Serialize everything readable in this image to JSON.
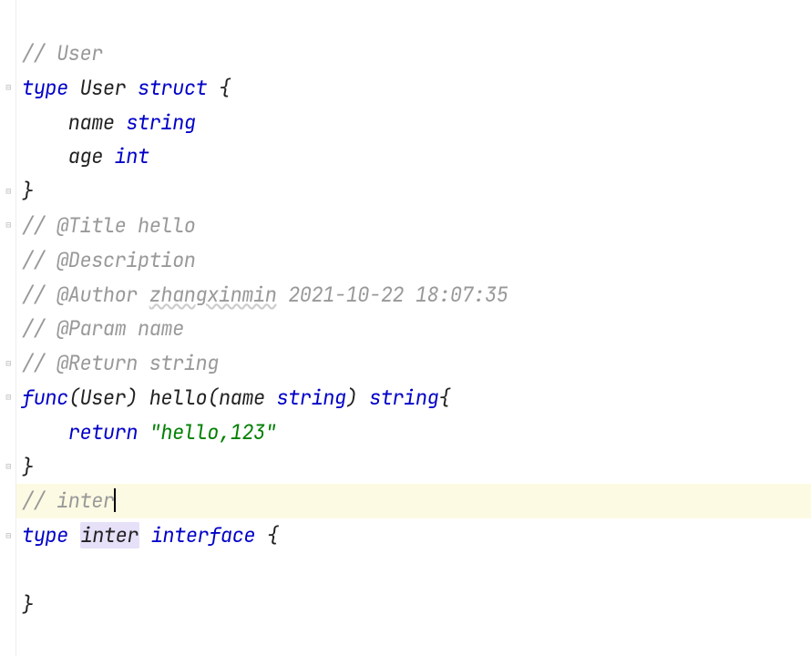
{
  "code": {
    "lines": [
      {
        "type": "comment",
        "segs": [
          {
            "cls": "comment",
            "text": "// User"
          }
        ]
      },
      {
        "type": "code",
        "segs": [
          {
            "cls": "kw",
            "text": "type "
          },
          {
            "cls": "cls",
            "text": "User "
          },
          {
            "cls": "kw",
            "text": "struct "
          },
          {
            "cls": "punct",
            "text": "{"
          }
        ]
      },
      {
        "type": "code",
        "segs": [
          {
            "cls": "ident",
            "text": "    name "
          },
          {
            "cls": "type",
            "text": "string"
          }
        ]
      },
      {
        "type": "code",
        "segs": [
          {
            "cls": "ident",
            "text": "    age "
          },
          {
            "cls": "type",
            "text": "int"
          }
        ]
      },
      {
        "type": "code",
        "segs": [
          {
            "cls": "punct",
            "text": "}"
          }
        ]
      },
      {
        "type": "comment",
        "segs": [
          {
            "cls": "comment",
            "text": "// @Title hello"
          }
        ]
      },
      {
        "type": "comment",
        "segs": [
          {
            "cls": "comment",
            "text": "// @Description"
          }
        ]
      },
      {
        "type": "comment",
        "segs": [
          {
            "cls": "comment",
            "text": "// @Author "
          },
          {
            "cls": "comment u",
            "text": "zhangxinmin"
          },
          {
            "cls": "comment",
            "text": " 2021-10-22 18:07:35"
          }
        ]
      },
      {
        "type": "comment",
        "segs": [
          {
            "cls": "comment",
            "text": "// @Param name"
          }
        ]
      },
      {
        "type": "comment",
        "segs": [
          {
            "cls": "comment",
            "text": "// @Return string"
          }
        ]
      },
      {
        "type": "code",
        "segs": [
          {
            "cls": "kw",
            "text": "func"
          },
          {
            "cls": "punct",
            "text": "("
          },
          {
            "cls": "cls",
            "text": "User"
          },
          {
            "cls": "punct",
            "text": ") "
          },
          {
            "cls": "ident",
            "text": "hello"
          },
          {
            "cls": "punct",
            "text": "("
          },
          {
            "cls": "param",
            "text": "name "
          },
          {
            "cls": "type",
            "text": "string"
          },
          {
            "cls": "punct",
            "text": ") "
          },
          {
            "cls": "type",
            "text": "string"
          },
          {
            "cls": "punct",
            "text": "{"
          }
        ]
      },
      {
        "type": "code",
        "segs": [
          {
            "cls": "ident",
            "text": "    "
          },
          {
            "cls": "kw",
            "text": "return "
          },
          {
            "cls": "str",
            "text": "\"hello,123\""
          }
        ]
      },
      {
        "type": "code",
        "segs": [
          {
            "cls": "punct",
            "text": "}"
          }
        ]
      },
      {
        "type": "comment-caret",
        "segs": [
          {
            "cls": "comment",
            "text": "// inter"
          }
        ]
      },
      {
        "type": "code",
        "segs": [
          {
            "cls": "kw",
            "text": "type "
          },
          {
            "cls": "ident name-hl",
            "text": "inter"
          },
          {
            "cls": "ident",
            "text": " "
          },
          {
            "cls": "kw",
            "text": "interface "
          },
          {
            "cls": "punct",
            "text": "{"
          }
        ]
      },
      {
        "type": "blank",
        "segs": []
      },
      {
        "type": "code",
        "segs": [
          {
            "cls": "punct",
            "text": "}"
          }
        ]
      }
    ]
  },
  "gutter": {
    "folds": [
      {
        "line": 1,
        "glyph": "⊟"
      },
      {
        "line": 4,
        "glyph": "⊟"
      },
      {
        "line": 5,
        "glyph": "⊟"
      },
      {
        "line": 9,
        "glyph": "⊟"
      },
      {
        "line": 10,
        "glyph": "⊟"
      },
      {
        "line": 12,
        "glyph": "⊟"
      },
      {
        "line": 14,
        "glyph": "⊟"
      }
    ]
  }
}
